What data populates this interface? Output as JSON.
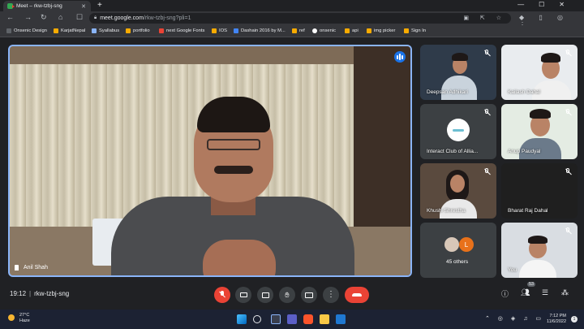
{
  "browser": {
    "tab_title": "Meet – rkw-tzbj-sng",
    "url_host": "meet.google.com",
    "url_path": "/rkw-tzbj-sng?pli=1",
    "bookmarks": [
      {
        "label": "Onsenic Design",
        "color": "#5f6368"
      },
      {
        "label": "KarjatNepal",
        "color": "#f9ab00"
      },
      {
        "label": "Syallabus",
        "color": "#8ab4f8"
      },
      {
        "label": "portfolio",
        "color": "#f9ab00"
      },
      {
        "label": "next Google Fonts",
        "color": "#ea4335"
      },
      {
        "label": "IOS",
        "color": "#f9ab00"
      },
      {
        "label": "Dashain 2016 by M...",
        "color": "#4285f4"
      },
      {
        "label": "ref",
        "color": "#f9ab00"
      },
      {
        "label": "onsenic",
        "color": "#ffffff"
      },
      {
        "label": "api",
        "color": "#f9ab00"
      },
      {
        "label": "img picker",
        "color": "#f9ab00"
      },
      {
        "label": "Sign In",
        "color": "#f9ab00"
      }
    ]
  },
  "meet": {
    "main_speaker": "Anil Shah",
    "participants": [
      {
        "name": "Deepsan Adhikari",
        "muted": true
      },
      {
        "name": "Kailash Dahal",
        "muted": true
      },
      {
        "name": "Interact Club of Allia...",
        "muted": true
      },
      {
        "name": "Anup Paudyal",
        "muted": true
      },
      {
        "name": "Khushi Shrestha",
        "muted": true
      },
      {
        "name": "Bharat Raj Dahal",
        "muted": true
      },
      {
        "name": "45 others",
        "muted": false
      },
      {
        "name": "You",
        "muted": true
      }
    ],
    "others_avatar_letter": "L",
    "time": "19:12",
    "meeting_code": "rkw-tzbj-sng",
    "participant_count": "53"
  },
  "taskbar": {
    "temperature": "27°C",
    "weather": "Haze",
    "clock_time": "7:12 PM",
    "clock_date": "11/6/2022",
    "notifications": "1"
  },
  "colors": {
    "accent_blue": "#8ab4f8",
    "red": "#ea4335",
    "dark_bg": "#202124"
  }
}
